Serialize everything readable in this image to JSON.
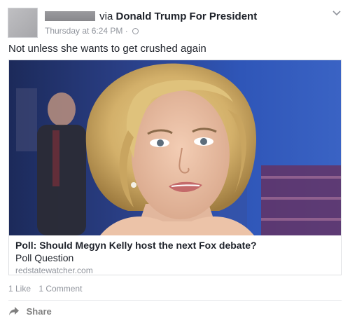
{
  "post": {
    "author_name_redacted": true,
    "via_label": "via",
    "page_name": "Donald Trump For President",
    "timestamp": "Thursday at 6:24 PM",
    "separator": "·",
    "privacy_icon": "globe-icon",
    "menu_icon": "chevron-down-icon",
    "message": "Not unless she wants to get crushed again"
  },
  "link_card": {
    "image_alt": "photo of a blonde woman at a debate event",
    "title": "Poll: Should Megyn Kelly host the next Fox debate?",
    "subtitle": "Poll Question",
    "domain": "redstatewatcher.com"
  },
  "stats": {
    "likes": "1 Like",
    "comments": "1 Comment"
  },
  "actions": {
    "share_label": "Share",
    "share_icon": "share-arrow-icon"
  },
  "colors": {
    "meta_gray": "#90949c",
    "text": "#1d2129",
    "border": "#dddfe2"
  }
}
